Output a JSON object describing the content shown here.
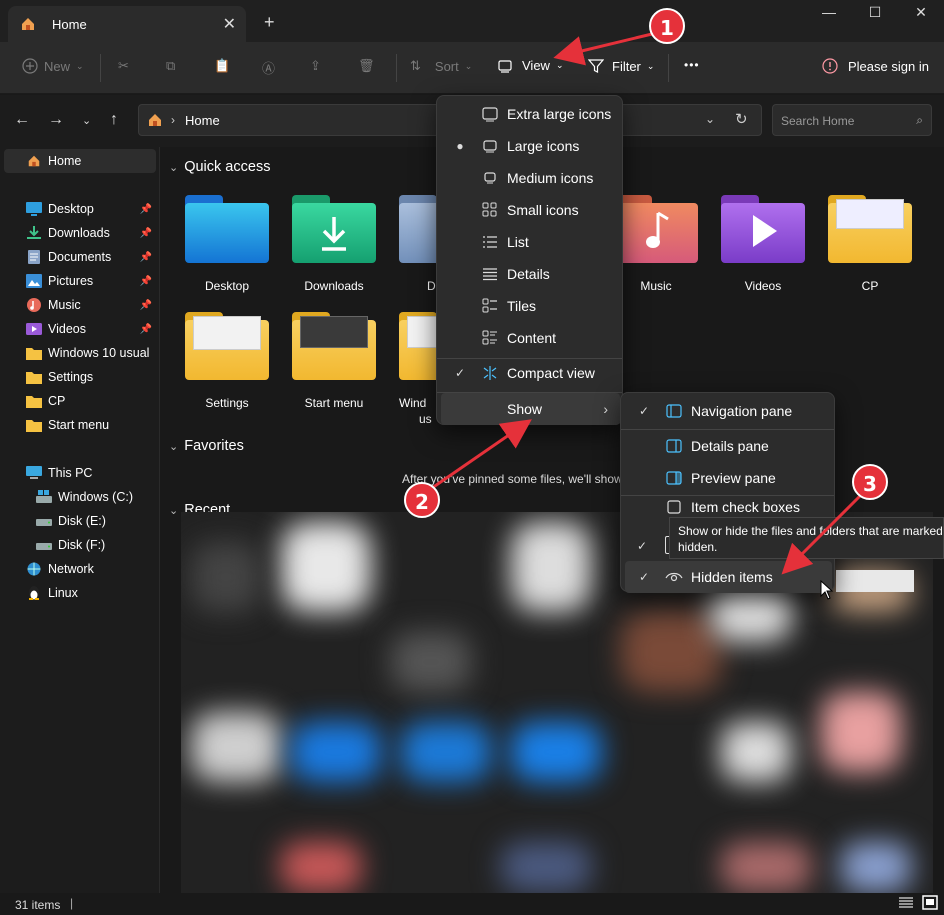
{
  "tab": {
    "title": "Home",
    "close": "✕"
  },
  "titlebar": {
    "new_tab": "+",
    "minimize": "—",
    "maximize": "☐",
    "close": "✕"
  },
  "toolbar": {
    "new": "New",
    "sort": "Sort",
    "view": "View",
    "filter": "Filter",
    "more": "•••",
    "sign_in": "Please sign in"
  },
  "address": {
    "path_segment": "Home"
  },
  "search": {
    "placeholder": "Search Home"
  },
  "sidebar": {
    "home": "Home",
    "pinned": [
      {
        "label": "Desktop",
        "icon": "desktop-icon"
      },
      {
        "label": "Downloads",
        "icon": "downloads-icon"
      },
      {
        "label": "Documents",
        "icon": "documents-icon"
      },
      {
        "label": "Pictures",
        "icon": "pictures-icon"
      },
      {
        "label": "Music",
        "icon": "music-icon"
      },
      {
        "label": "Videos",
        "icon": "videos-icon"
      }
    ],
    "folders": [
      "Windows 10 usual",
      "Settings",
      "CP",
      "Start menu"
    ],
    "this_pc": "This PC",
    "drives": [
      "Windows (C:)",
      "Disk (E:)",
      "Disk (F:)"
    ],
    "network": "Network",
    "linux": "Linux"
  },
  "content": {
    "quick_access": "Quick access",
    "favorites": "Favorites",
    "recent": "Recent",
    "favorites_empty": "After you've pinned some files, we'll show",
    "tiles_row1": [
      "Desktop",
      "Downloads",
      "Docu",
      "Music",
      "Videos",
      "CP"
    ],
    "tiles_row2": [
      "Settings",
      "Start menu",
      "Wind",
      "us"
    ]
  },
  "view_menu": {
    "items": [
      "Extra large icons",
      "Large icons",
      "Medium icons",
      "Small icons",
      "List",
      "Details",
      "Tiles",
      "Content"
    ],
    "compact": "Compact view",
    "show": "Show"
  },
  "show_menu": {
    "items": [
      "Navigation pane",
      "Details pane",
      "Preview pane",
      "Item check boxes",
      "Hidden items"
    ]
  },
  "tooltip": {
    "line1": "Show or hide the files and folders that are marked",
    "line2": "hidden."
  },
  "badges": [
    "1",
    "2",
    "3"
  ],
  "status": {
    "items": "31 items"
  },
  "colors": {
    "accent": "#4cc2ff",
    "badge": "#e5313a",
    "folder": "#f5c242"
  }
}
